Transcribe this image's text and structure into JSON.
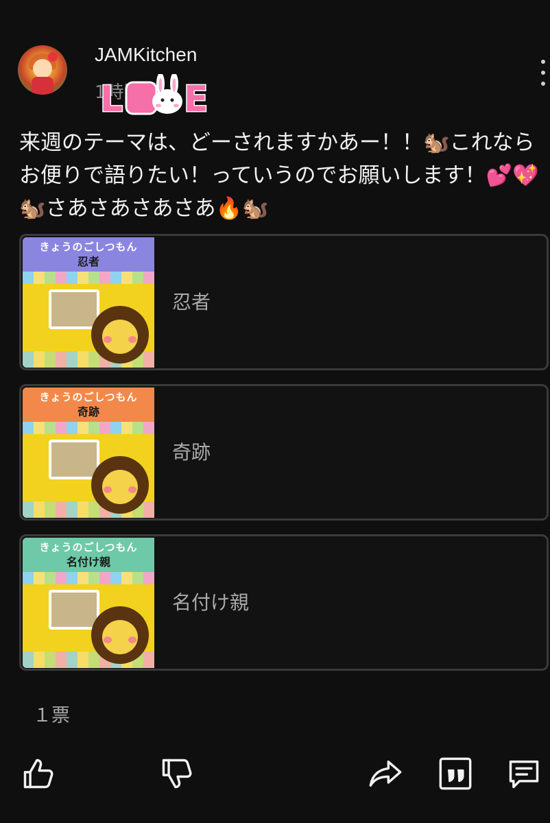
{
  "post": {
    "channel_name": "JAMKitchen",
    "timestamp": "1時間前",
    "text": "来週のテーマは、どーされますかあー！！🐿️これならお便りで語りたい！っていうのでお願いします！💕💖🐿️さあさあさあさあ🔥🐿️"
  },
  "poll": {
    "options": [
      {
        "label": "忍者",
        "thumb_title": "きょうのごしつもん",
        "thumb_subtitle": "忍者",
        "thumb_color": "#8a86e0"
      },
      {
        "label": "奇跡",
        "thumb_title": "きょうのごしつもん",
        "thumb_subtitle": "奇跡",
        "thumb_color": "#f2894a"
      },
      {
        "label": "名付け親",
        "thumb_title": "きょうのごしつもん",
        "thumb_subtitle": "名付け親",
        "thumb_color": "#6ec9a8"
      }
    ],
    "vote_count": "１票"
  },
  "icons": {
    "more": "more-vert-icon",
    "like": "thumbs-up-icon",
    "dislike": "thumbs-down-icon",
    "share": "share-icon",
    "quote": "quote-icon",
    "comment": "comment-icon"
  },
  "colors": {
    "background": "#0f0f0f",
    "text_primary": "#f1f1f1",
    "text_secondary": "#aaaaaa",
    "option_border": "#3a3a3a",
    "sticker_pink": "#f56fa8"
  }
}
